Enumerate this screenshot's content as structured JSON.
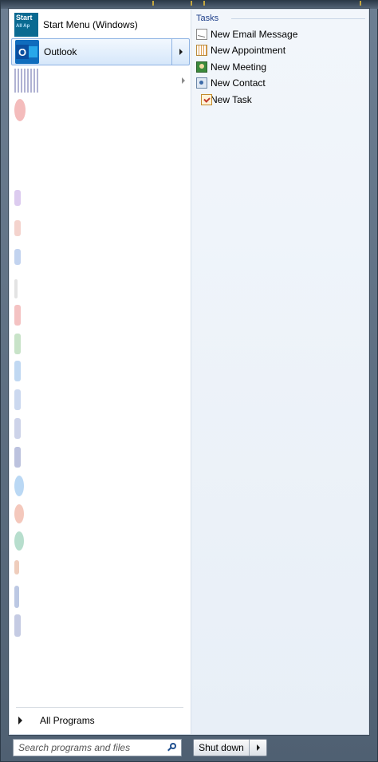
{
  "start_menu": {
    "pinned": [
      {
        "label": "Start Menu (Windows)",
        "icon": "start-menu-icon",
        "icon_text": "Start",
        "icon_subtext": "All Ap"
      },
      {
        "label": "Outlook",
        "icon": "outlook-icon",
        "icon_letter": "O",
        "selected": true,
        "has_submenu": true
      }
    ],
    "all_programs_label": "All Programs",
    "search": {
      "placeholder": "Search programs and files"
    },
    "shutdown_label": "Shut down"
  },
  "jump_list": {
    "header": "Tasks",
    "tasks": [
      {
        "label": "New Email Message",
        "icon": "email-icon"
      },
      {
        "label": "New Appointment",
        "icon": "calendar-icon"
      },
      {
        "label": "New Meeting",
        "icon": "meeting-icon"
      },
      {
        "label": "New Contact",
        "icon": "contact-icon"
      },
      {
        "label": "New Task",
        "icon": "task-icon"
      }
    ]
  },
  "colors": {
    "accent": "#1e3f8a",
    "selection_border": "#8db2e3",
    "outlook_blue": "#0f6cbd"
  }
}
